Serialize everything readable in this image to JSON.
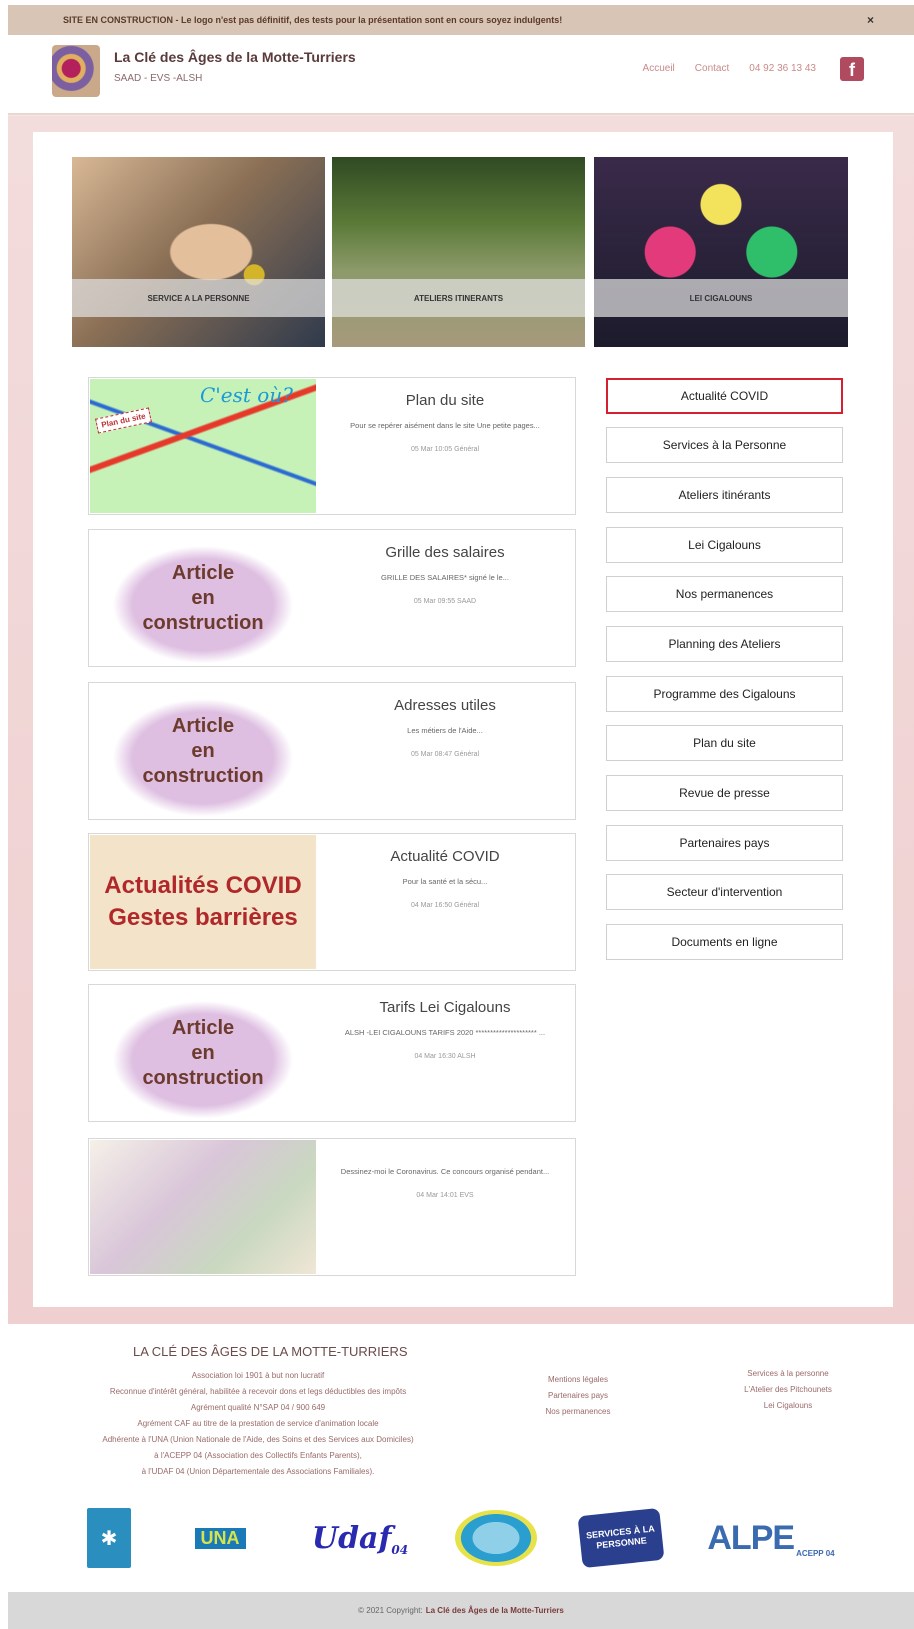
{
  "announcement": {
    "text": "SITE EN CONSTRUCTION - Le logo n'est pas définitif, des tests pour la présentation sont en cours soyez indulgents!",
    "close": "×"
  },
  "header": {
    "title": "La Clé des Âges de la Motte-Turriers",
    "subtitle": "SAAD - EVS -ALSH",
    "nav": [
      "Accueil",
      "Contact",
      "04 92 36 13 43"
    ],
    "facebook": "f"
  },
  "hero": [
    {
      "caption": "SERVICE A LA PERSONNE"
    },
    {
      "caption": "ATELIERS ITINERANTS"
    },
    {
      "caption": "LEI CIGALOUNS"
    }
  ],
  "map_thumb": {
    "text1": "C'est où?",
    "text2": "Plan du site"
  },
  "articles": [
    {
      "title": "Plan du site",
      "excerpt": "Pour se repérer aisément dans le site Une petite pages...",
      "meta": "05 Mar 10:05 Général"
    },
    {
      "title": "Grille des salaires",
      "excerpt": "GRILLE DES SALAIRES* signé le le...",
      "meta": "05 Mar 09:55 SAAD"
    },
    {
      "title": "Adresses utiles",
      "excerpt": "Les métiers de l'Aide...",
      "meta": "05 Mar 08:47 Général"
    },
    {
      "title": "Actualité COVID",
      "excerpt": "Pour la santé et la sécu...",
      "meta": "04 Mar 16:50 Général"
    },
    {
      "title": "Tarifs Lei Cigalouns",
      "excerpt": "ALSH -LEI CIGALOUNS TARIFS 2020 ********************* ...",
      "meta": "04 Mar 16:30 ALSH"
    },
    {
      "title": "",
      "excerpt": "Dessinez-moi le Coronavirus. Ce concours organisé pendant...",
      "meta": "04 Mar 14:01 EVS"
    }
  ],
  "construction_thumb": {
    "line1": "Article",
    "line2": "en",
    "line3": "construction"
  },
  "covid_thumb": {
    "line1": "Actualités COVID",
    "line2": "Gestes barrières"
  },
  "sidebar": [
    "Actualité COVID",
    "Services à la Personne",
    "Ateliers itinérants",
    "Lei Cigalouns",
    "Nos permanences",
    "Planning des Ateliers",
    "Programme des Cigalouns",
    "Plan du site",
    "Revue de presse",
    "Partenaires pays",
    "Secteur d'intervention",
    "Documents en ligne"
  ],
  "footer": {
    "title": "LA CLÉ DES ÂGES DE LA MOTTE-TURRIERS",
    "lines": [
      "Association loi 1901 à but non lucratif",
      "Reconnue d'intérêt général, habilitée à recevoir dons et legs déductibles des impôts",
      "Agrément qualité N°SAP 04 / 900 649",
      "Agrément CAF au titre de la prestation de service d'animation locale",
      "Adhérente à l'UNA (Union Nationale de l'Aide, des Soins et des Services aux Domiciles)",
      "à l'ACEPP 04 (Association des Collectifs Enfants Parents),",
      "à l'UDAF 04 (Union Départementale des Associations Familiales)."
    ],
    "col2": [
      "Mentions légales",
      "Partenaires pays",
      "Nos permanences"
    ],
    "col3": [
      "Services à la personne",
      "L'Atelier des Pitchounets",
      "Lei Cigalouns"
    ]
  },
  "partners": [
    "UNA",
    "Udaf",
    "04",
    "SERVICES À LA PERSONNE",
    "ALPE",
    "ACEPP 04"
  ],
  "copyright": {
    "prefix": "© 2021 Copyright:",
    "name": "La Clé des Âges de la Motte-Turriers"
  }
}
